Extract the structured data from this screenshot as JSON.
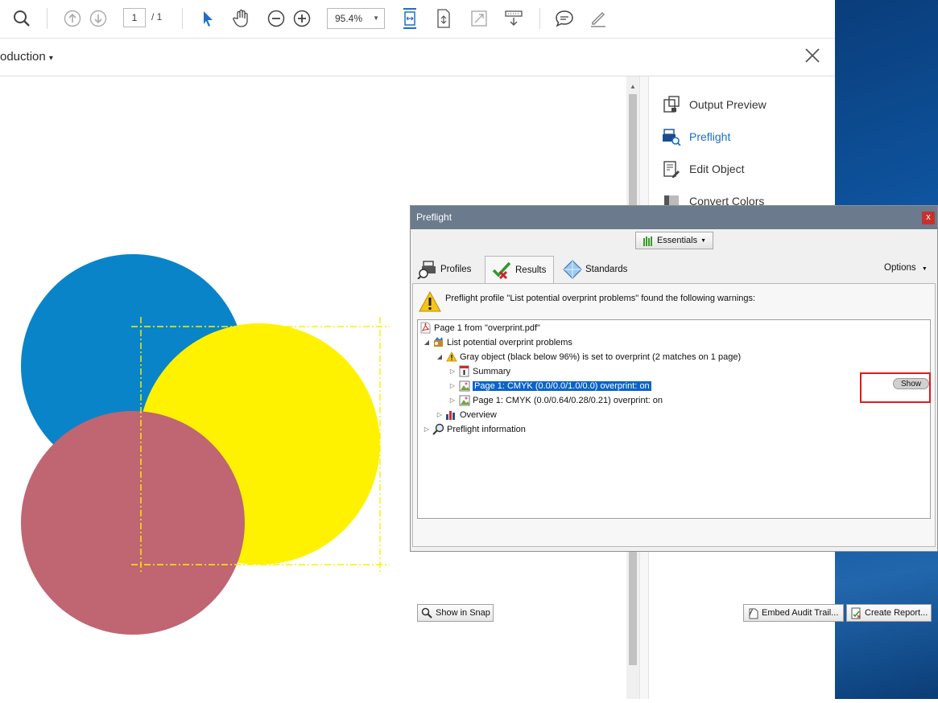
{
  "toolbar": {
    "page_current": "1",
    "page_total": "/  1",
    "zoom": "95.4%"
  },
  "secondary_bar": {
    "title": "oduction",
    "title_caret": "▾"
  },
  "right_pane": {
    "items": [
      {
        "label": "Output Preview",
        "icon": "output-preview-icon"
      },
      {
        "label": "Preflight",
        "icon": "preflight-icon",
        "active": true
      },
      {
        "label": "Edit Object",
        "icon": "edit-object-icon"
      },
      {
        "label": "Convert Colors",
        "icon": "convert-colors-icon"
      }
    ]
  },
  "document": {
    "circle_colors": {
      "blue": "#0a84c8",
      "yellow": "#fff200",
      "rose": "#c06572"
    }
  },
  "preflight": {
    "title": "Preflight",
    "close_label": "x",
    "essentials_label": "Essentials",
    "tabs": [
      {
        "label": "Profiles"
      },
      {
        "label": "Results"
      },
      {
        "label": "Standards"
      }
    ],
    "options_label": "Options",
    "warning_message": "Preflight profile \"List potential overprint problems\" found the following warnings:",
    "tree": [
      {
        "label": "Page 1 from \"overprint.pdf\""
      },
      {
        "label": "List potential overprint problems"
      },
      {
        "label": "Gray object (black below 96%) is set to overprint (2 matches on 1 page)"
      },
      {
        "label": "Summary"
      },
      {
        "label": "Page 1: CMYK (0.0/0.0/1.0/0.0)  overprint: on"
      },
      {
        "label": "Page 1: CMYK (0.0/0.64/0.28/0.21)  overprint: on"
      },
      {
        "label": "Overview"
      },
      {
        "label": "Preflight information"
      }
    ],
    "show_button": "Show",
    "buttons": {
      "show_in_snap": "Show in Snap",
      "embed_audit_trail": "Embed Audit Trail...",
      "create_report": "Create Report..."
    }
  }
}
